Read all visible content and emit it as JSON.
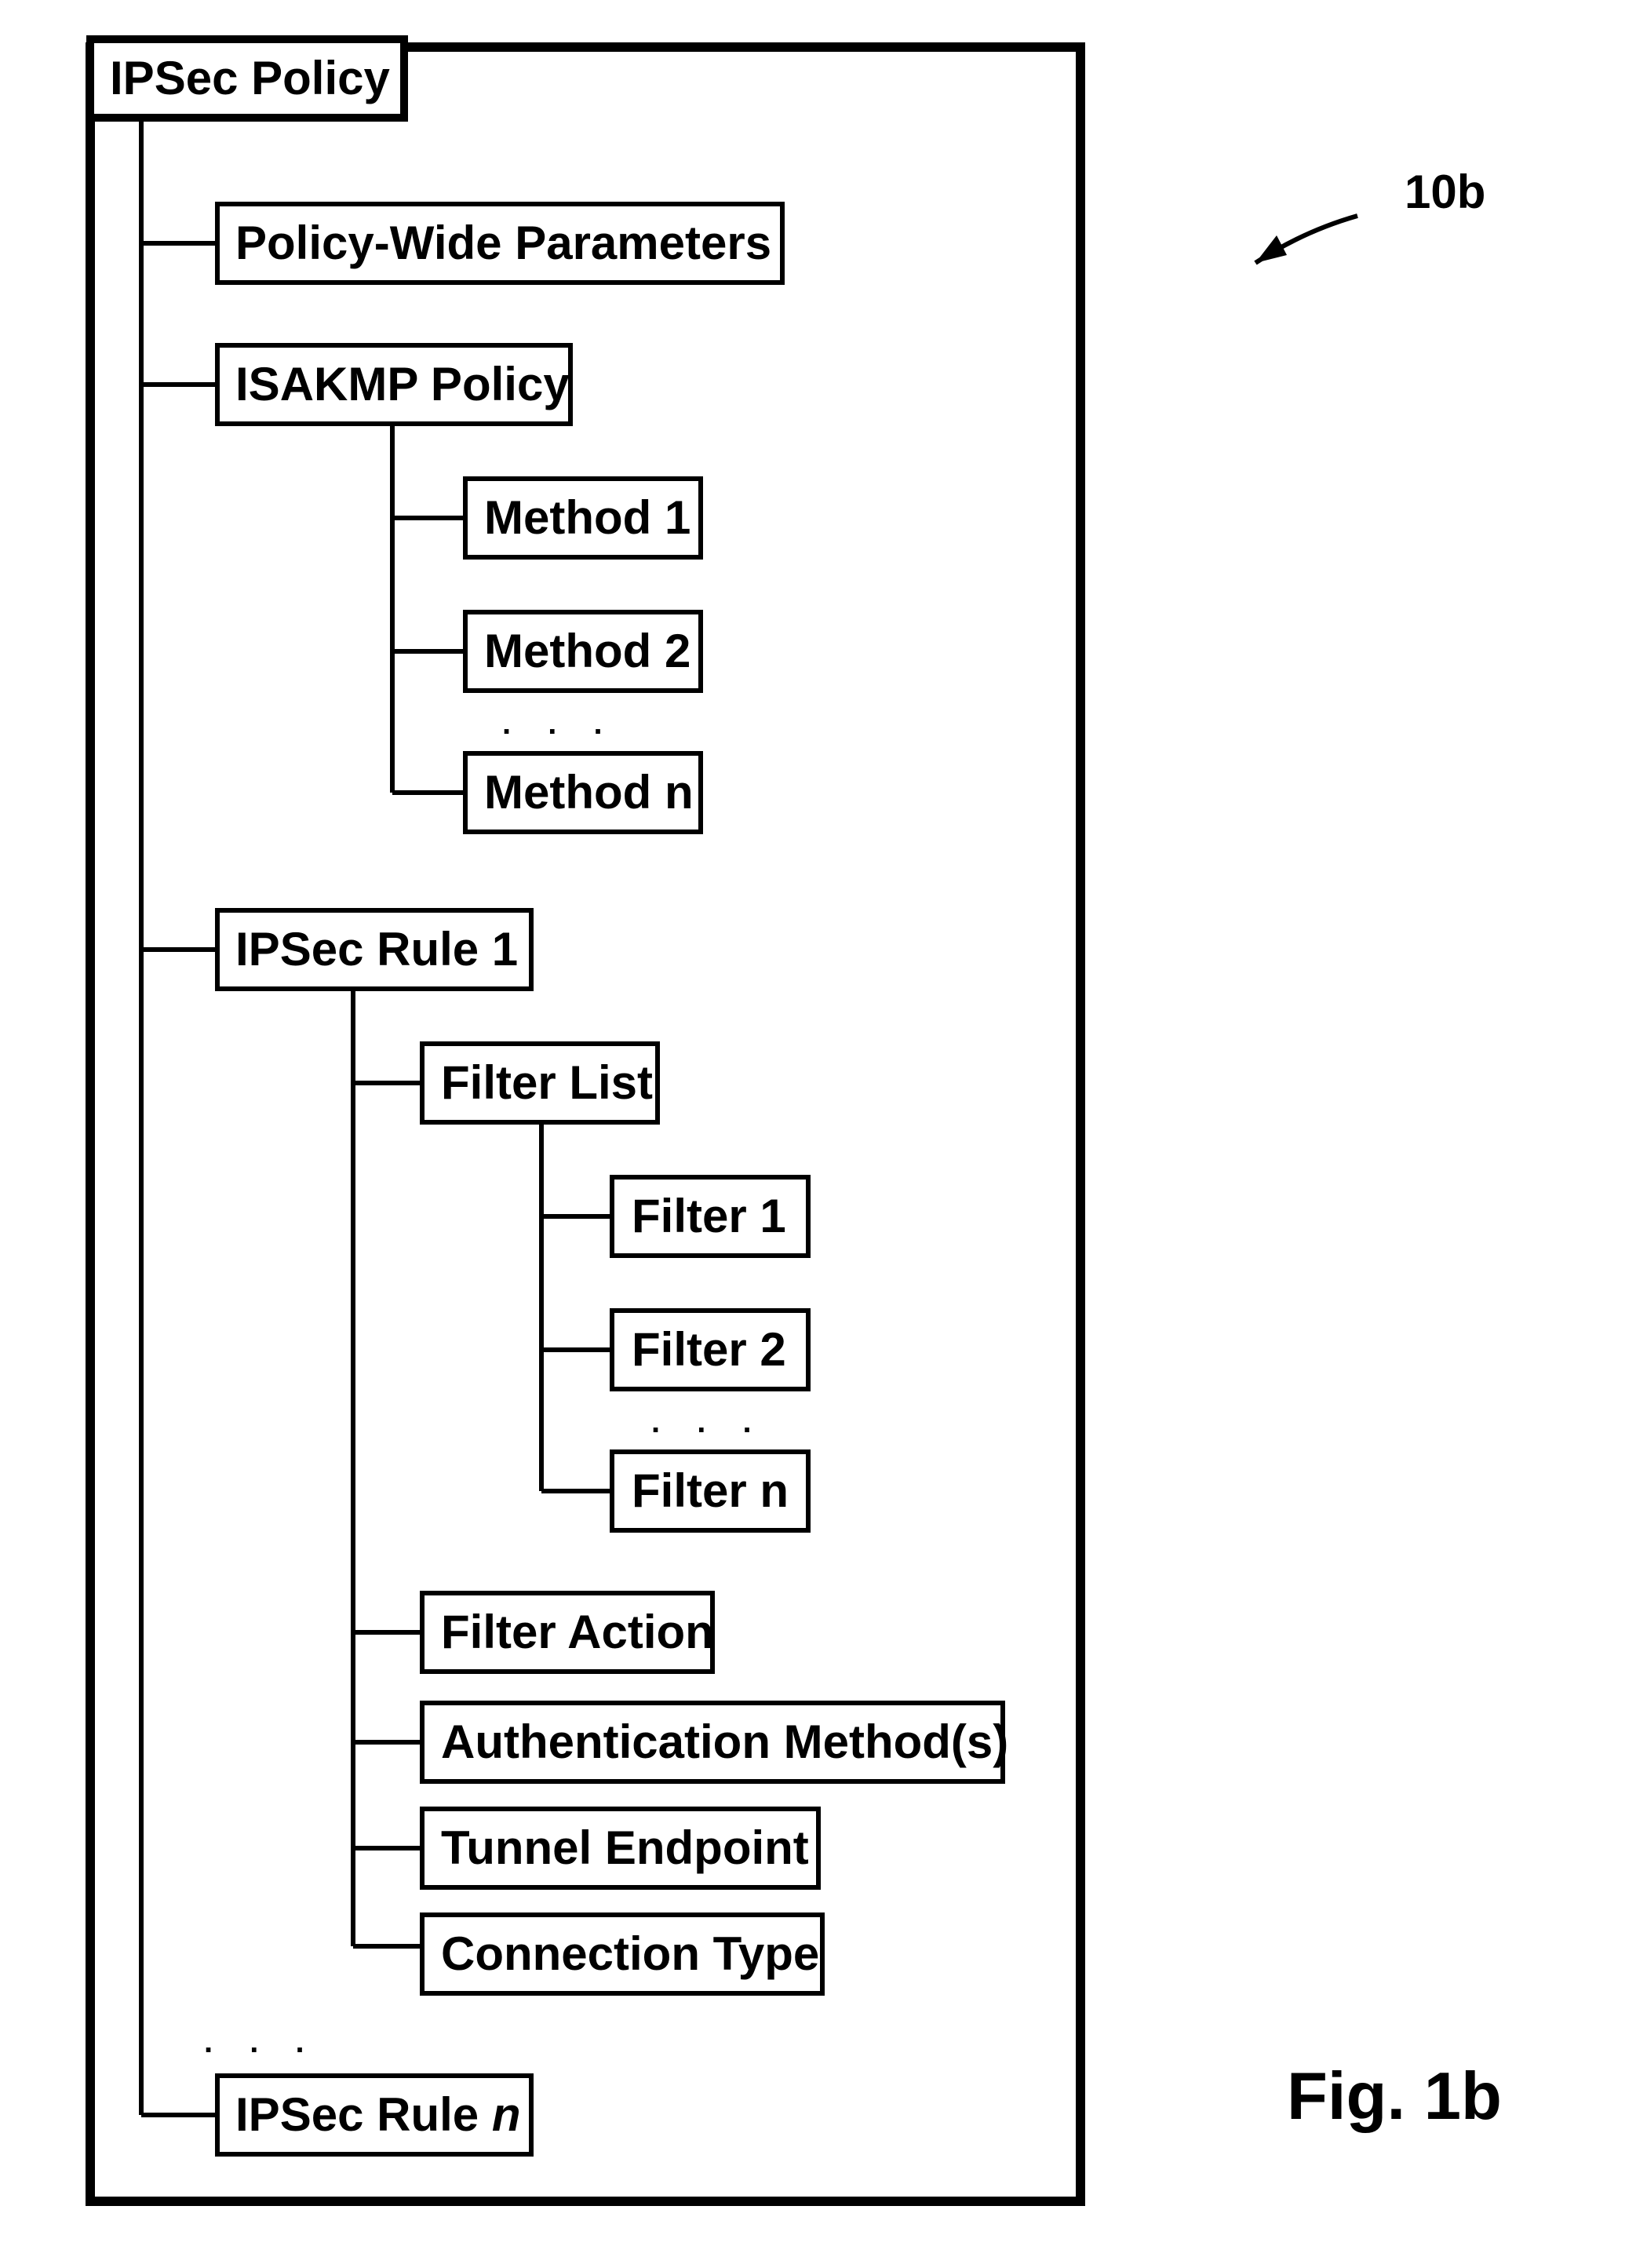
{
  "figure_label": "Fig. 1b",
  "ref_label": "10b",
  "root": "IPSec Policy",
  "policy_wide": "Policy-Wide Parameters",
  "isakmp": "ISAKMP Policy",
  "methods": [
    "Method 1",
    "Method 2",
    "Method n"
  ],
  "rule1": "IPSec Rule 1",
  "filter_list": "Filter List",
  "filters": [
    "Filter 1",
    "Filter 2",
    "Filter n"
  ],
  "filter_action": "Filter Action",
  "auth": "Authentication Method(s)",
  "tunnel": "Tunnel Endpoint",
  "conn": "Connection Type",
  "rule_n": "IPSec Rule n",
  "dots": ". . ."
}
